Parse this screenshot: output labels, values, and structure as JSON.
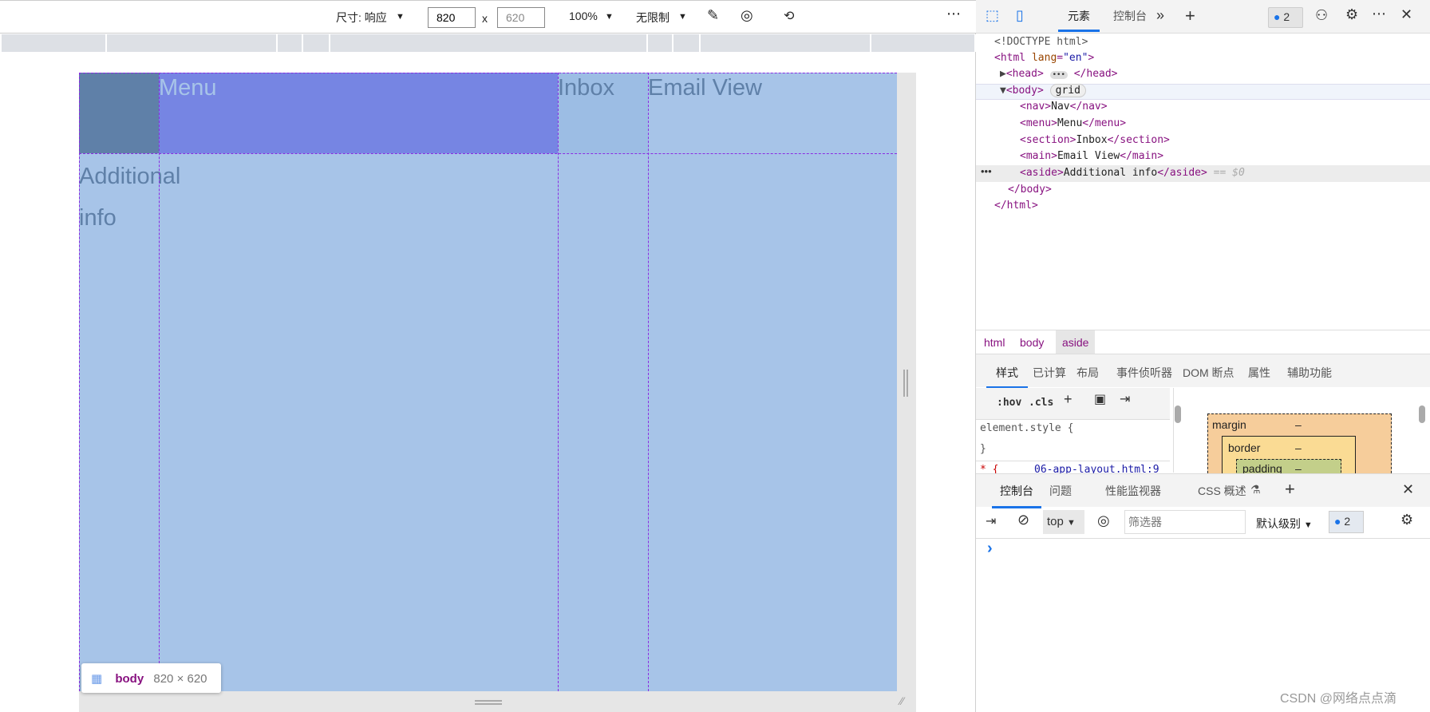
{
  "device_toolbar": {
    "dimensions_label": "尺寸: 响应",
    "width": "820",
    "times": "x",
    "height": "620",
    "zoom": "100%",
    "throttle": "无限制",
    "more": "⋯"
  },
  "grid": {
    "menu": "Menu",
    "inbox": "Inbox",
    "email_view": "Email View",
    "additional_info": "Additional info"
  },
  "badge": {
    "element": "body",
    "size": "820 × 620"
  },
  "devtools": {
    "tabs": [
      "元素",
      "控制台"
    ],
    "issues_count": "2",
    "dom_lines": {
      "doctype": "<!DOCTYPE html>",
      "grid_badge": "grid",
      "nav": "Nav",
      "menu": "Menu",
      "section": "Inbox",
      "main": "Email View",
      "aside": "Additional info",
      "selected_marker": "== $0"
    },
    "breadcrumbs": [
      "html",
      "body",
      "aside"
    ],
    "style_tabs": [
      "样式",
      "已计算",
      "布局",
      "事件侦听器",
      "DOM 断点",
      "属性",
      "辅助功能"
    ],
    "styles": {
      "hov": ":hov",
      "cls": ".cls",
      "element_style": "element.style {",
      "close_brace": "}",
      "rule_selector": "* {",
      "rule_source": "06-app-layout.html:9"
    },
    "box_model": {
      "margin": "margin",
      "border": "border",
      "padding": "padding",
      "dash": "–"
    },
    "drawer_tabs": [
      "控制台",
      "问题",
      "性能监视器",
      "CSS 概述"
    ],
    "console": {
      "context": "top",
      "filter_placeholder": "筛选器",
      "level": "默认级别",
      "issues": "2",
      "prompt": "›"
    }
  },
  "watermark": "CSDN @网络点点滴",
  "colors": {
    "nav": "#5f80a8",
    "menu": "#7685e3",
    "inbox": "#9cbde4",
    "rest": "#a7c4e8",
    "accent": "#1a73e8",
    "grid_lines": "#8a2be2"
  }
}
